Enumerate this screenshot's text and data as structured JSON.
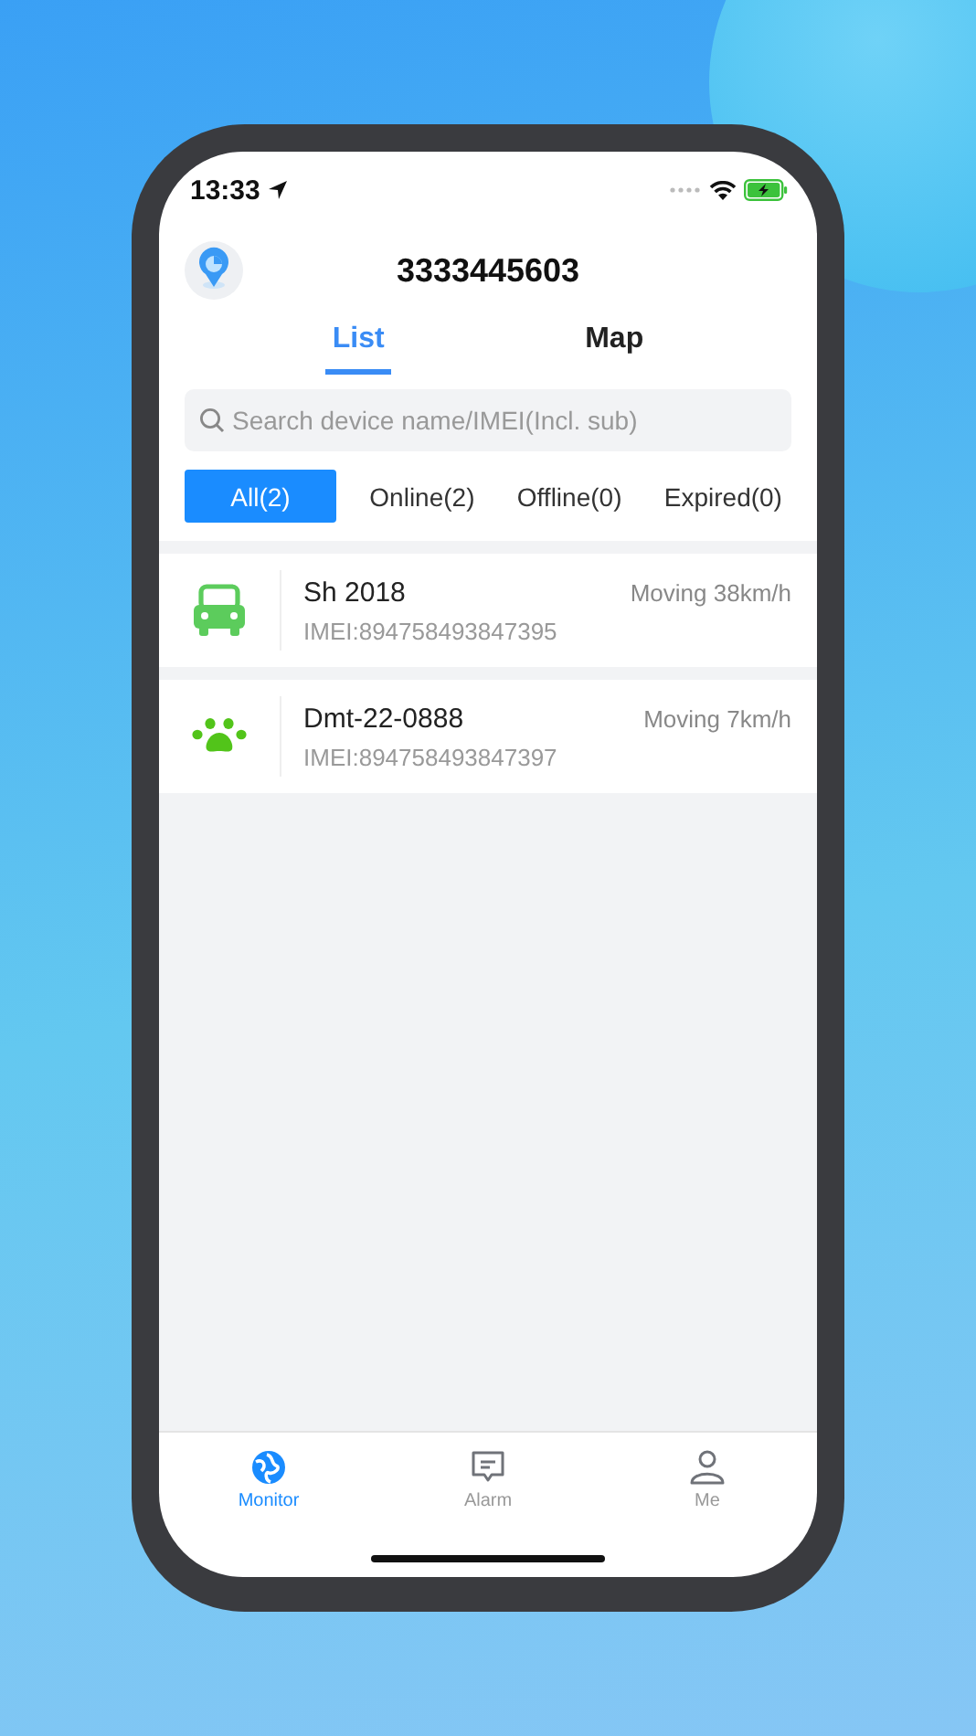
{
  "status_bar": {
    "time": "13:33"
  },
  "header": {
    "title": "3333445603"
  },
  "tabs": [
    {
      "label": "List",
      "selected": true
    },
    {
      "label": "Map",
      "selected": false
    }
  ],
  "search": {
    "placeholder": "Search device name/IMEI(Incl. sub)"
  },
  "filters": [
    {
      "label": "All(2)",
      "selected": true
    },
    {
      "label": "Online(2)",
      "selected": false
    },
    {
      "label": "Offline(0)",
      "selected": false
    },
    {
      "label": "Expired(0)",
      "selected": false
    }
  ],
  "devices": [
    {
      "kind": "car",
      "name": "Sh 2018",
      "imei": "IMEI:894758493847395",
      "status": "Moving 38km/h"
    },
    {
      "kind": "pet",
      "name": "Dmt-22-0888",
      "imei": "IMEI:894758493847397",
      "status": "Moving 7km/h"
    }
  ],
  "nav": [
    {
      "kind": "monitor",
      "label": "Monitor",
      "selected": true
    },
    {
      "kind": "alarm",
      "label": "Alarm",
      "selected": false
    },
    {
      "kind": "me",
      "label": "Me",
      "selected": false
    }
  ]
}
